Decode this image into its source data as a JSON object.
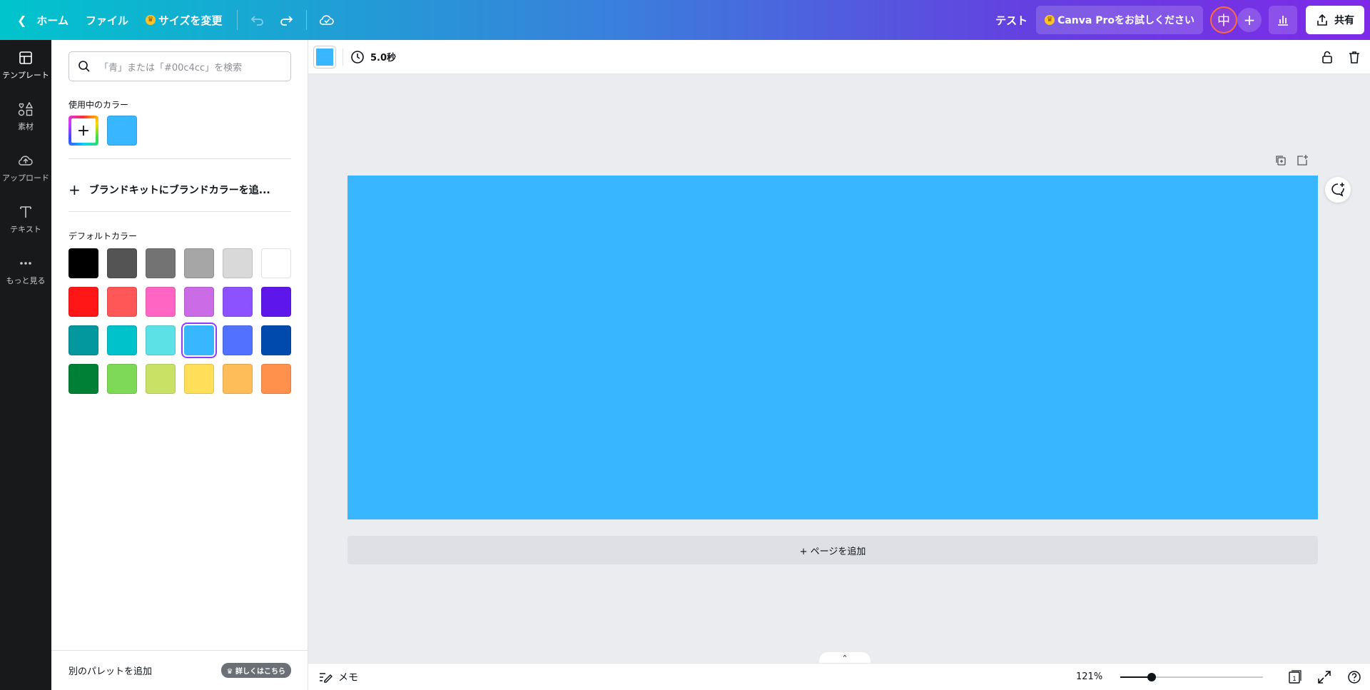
{
  "topbar": {
    "home_label": "ホーム",
    "file_label": "ファイル",
    "resize_label": "サイズを変更",
    "project_name": "テスト",
    "pro_label": "Canva Proをお試しください",
    "avatar_initial": "中",
    "share_label": "共有"
  },
  "rail": {
    "items": [
      {
        "label": "テンプレート",
        "icon": "template-icon"
      },
      {
        "label": "素材",
        "icon": "elements-icon"
      },
      {
        "label": "アップロード",
        "icon": "upload-icon"
      },
      {
        "label": "テキスト",
        "icon": "text-icon"
      },
      {
        "label": "もっと見る",
        "icon": "more-icon"
      }
    ]
  },
  "panel": {
    "search_placeholder": "「青」または「#00c4cc」を検索",
    "in_use_label": "使用中のカラー",
    "in_use_colors": [
      "#38b6ff"
    ],
    "brandkit_label": "ブランドキットにブランドカラーを追...",
    "default_label": "デフォルトカラー",
    "default_colors": [
      "#000000",
      "#545454",
      "#737373",
      "#a6a6a6",
      "#d9d9d9",
      "#ffffff",
      "#ff1616",
      "#ff5757",
      "#ff66c4",
      "#cb6ce6",
      "#8c52ff",
      "#5e17eb",
      "#03989e",
      "#00c2cb",
      "#5ce1e6",
      "#38b6ff",
      "#5271ff",
      "#004aad",
      "#008037",
      "#7ed957",
      "#c9e265",
      "#ffde59",
      "#ffbd59",
      "#ff914d"
    ],
    "selected_color": "#38b6ff",
    "footer_label": "別のパレットを追加",
    "footer_badge": "詳しくはこちら"
  },
  "editor": {
    "current_color": "#38b6ff",
    "duration": "5.0秒",
    "page_color": "#38b6ff",
    "add_page_label": "+ ページを追加"
  },
  "bottombar": {
    "memo_label": "メモ",
    "zoom": "121%",
    "zoom_fraction": 0.22,
    "page_count": "1"
  }
}
